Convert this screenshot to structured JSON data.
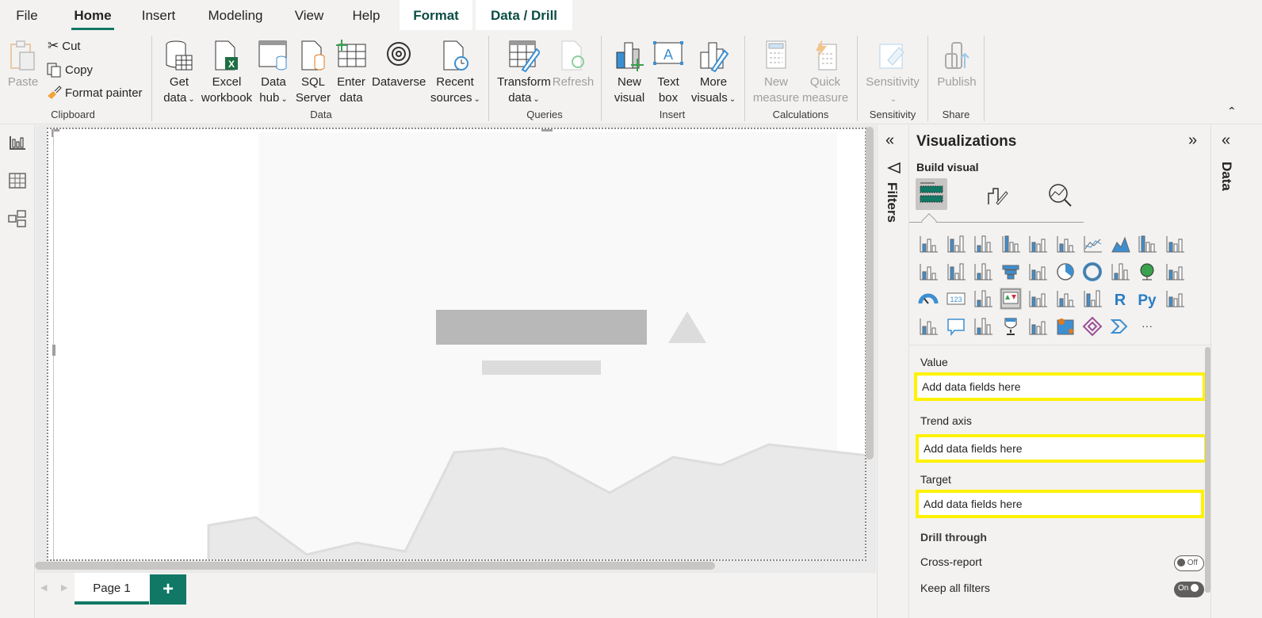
{
  "menu": {
    "tabs": [
      {
        "label": "File"
      },
      {
        "label": "Home",
        "active": true
      },
      {
        "label": "Insert"
      },
      {
        "label": "Modeling"
      },
      {
        "label": "View"
      },
      {
        "label": "Help"
      },
      {
        "label": "Format",
        "contextual": true
      },
      {
        "label": "Data / Drill",
        "contextual": true
      }
    ]
  },
  "ribbon": {
    "clipboard": {
      "paste": "Paste",
      "cut": "Cut",
      "copy": "Copy",
      "format_painter": "Format painter",
      "group": "Clipboard"
    },
    "data": {
      "get_data": [
        "Get",
        "data"
      ],
      "excel": [
        "Excel",
        "workbook"
      ],
      "data_hub": [
        "Data",
        "hub"
      ],
      "sql": [
        "SQL",
        "Server"
      ],
      "enter_data": [
        "Enter",
        "data"
      ],
      "dataverse": "Dataverse",
      "recent": [
        "Recent",
        "sources"
      ],
      "group": "Data"
    },
    "queries": {
      "transform": [
        "Transform",
        "data"
      ],
      "refresh": "Refresh",
      "group": "Queries"
    },
    "insert": {
      "new_visual": [
        "New",
        "visual"
      ],
      "text_box": [
        "Text",
        "box"
      ],
      "more_visuals": [
        "More",
        "visuals"
      ],
      "group": "Insert"
    },
    "calculations": {
      "new_measure": [
        "New",
        "measure"
      ],
      "quick_measure": [
        "Quick",
        "measure"
      ],
      "group": "Calculations"
    },
    "sensitivity": {
      "label": "Sensitivity",
      "group": "Sensitivity"
    },
    "share": {
      "publish": "Publish",
      "group": "Share"
    }
  },
  "pages": {
    "tabs": [
      {
        "label": "Page 1",
        "active": true
      }
    ],
    "add_label": "+"
  },
  "filters": {
    "label": "Filters"
  },
  "visualizations": {
    "title": "Visualizations",
    "build_visual": "Build visual",
    "wells": [
      {
        "label": "Value",
        "placeholder": "Add data fields here"
      },
      {
        "label": "Trend axis",
        "placeholder": "Add data fields here"
      },
      {
        "label": "Target",
        "placeholder": "Add data fields here"
      }
    ],
    "drill_through": {
      "title": "Drill through",
      "cross_report": {
        "label": "Cross-report",
        "state": "Off"
      },
      "keep_all_filters": {
        "label": "Keep all filters",
        "state": "On"
      }
    },
    "more_label": "···"
  },
  "data_pane": {
    "label": "Data"
  },
  "colors": {
    "accent": "#117865",
    "highlight": "#fff200",
    "icon_blue": "#3d8fd1"
  }
}
